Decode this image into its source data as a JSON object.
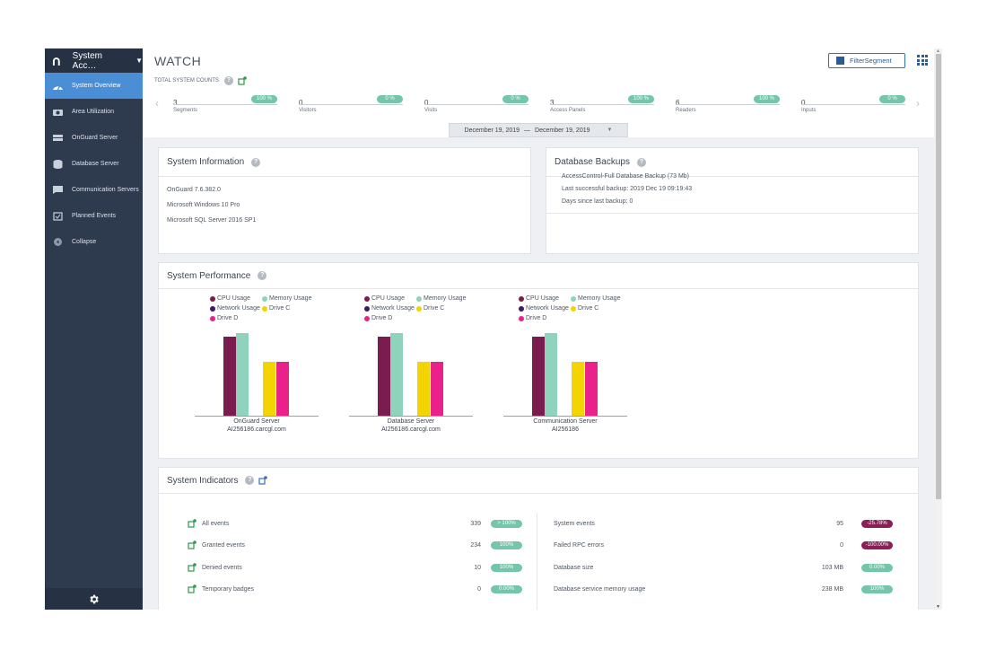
{
  "sidebar": {
    "account": "System Acc…",
    "items": [
      {
        "label": "System Overview",
        "icon": "gauge-icon",
        "active": true
      },
      {
        "label": "Area Utilization",
        "icon": "camera-icon",
        "active": false
      },
      {
        "label": "OnGuard Server",
        "icon": "server-icon",
        "active": false
      },
      {
        "label": "Database Server",
        "icon": "database-icon",
        "active": false
      },
      {
        "label": "Communication Servers",
        "icon": "chat-icon",
        "active": false
      },
      {
        "label": "Planned Events",
        "icon": "calendar-icon",
        "active": false
      },
      {
        "label": "Collapse",
        "icon": "collapse-icon",
        "active": false
      }
    ],
    "settings_icon": "gear-icon"
  },
  "header": {
    "title": "WATCH",
    "filter_button": "FilterSegment",
    "total_counts_label": "TOTAL SYSTEM COUNTS"
  },
  "counts": [
    {
      "value": "3",
      "label": "Segments",
      "pct": "100 %"
    },
    {
      "value": "0",
      "label": "Visitors",
      "pct": "0 %"
    },
    {
      "value": "0",
      "label": "Visits",
      "pct": "0 %"
    },
    {
      "value": "3",
      "label": "Access Panels",
      "pct": "100 %"
    },
    {
      "value": "6",
      "label": "Readers",
      "pct": "100 %"
    },
    {
      "value": "0",
      "label": "Inputs",
      "pct": "0 %"
    }
  ],
  "date_range": {
    "start": "December 19, 2019",
    "separator": "—",
    "end": "December 19, 2019"
  },
  "system_information": {
    "title": "System Information",
    "lines": [
      "OnGuard 7.6.382.0",
      "Microsoft Windows 10 Pro",
      "Microsoft SQL Server 2016 SP1"
    ]
  },
  "database_backups": {
    "title": "Database Backups",
    "lines": [
      "AccessControl-Full Database Backup (73 Mb)",
      "Last successful backup: 2019 Dec 19 09:19:43",
      "Days since last backup: 0"
    ]
  },
  "system_performance": {
    "title": "System Performance",
    "legend": [
      {
        "name": "CPU Usage",
        "color": "#7b1c4f"
      },
      {
        "name": "Memory Usage",
        "color": "#8fd3bd"
      },
      {
        "name": "Network Usage",
        "color": "#3d1b63"
      },
      {
        "name": "Drive C",
        "color": "#f4d400"
      },
      {
        "name": "Drive D",
        "color": "#e8228a"
      }
    ]
  },
  "chart_data": [
    {
      "type": "bar",
      "title": "",
      "categories": [
        "CPU Usage",
        "Memory Usage",
        "Drive C",
        "Drive D"
      ],
      "values": [
        88,
        92,
        60,
        60
      ],
      "ylim": [
        0,
        100
      ],
      "caption": [
        "OnGuard Server",
        "AI256186.carcgl.com"
      ]
    },
    {
      "type": "bar",
      "title": "",
      "categories": [
        "CPU Usage",
        "Memory Usage",
        "Drive C",
        "Drive D"
      ],
      "values": [
        88,
        92,
        60,
        60
      ],
      "ylim": [
        0,
        100
      ],
      "caption": [
        "Database Server",
        "AI256186.carcgl.com"
      ]
    },
    {
      "type": "bar",
      "title": "",
      "categories": [
        "CPU Usage",
        "Memory Usage",
        "Drive C",
        "Drive D"
      ],
      "values": [
        88,
        92,
        60,
        60
      ],
      "ylim": [
        0,
        100
      ],
      "caption": [
        "Communication Server",
        "AI256186"
      ]
    }
  ],
  "system_indicators": {
    "title": "System Indicators",
    "left": [
      {
        "label": "All events",
        "value": "339",
        "pct": "> 100%",
        "color": "green"
      },
      {
        "label": "Granted events",
        "value": "234",
        "pct": "100%",
        "color": "green"
      },
      {
        "label": "Denied events",
        "value": "10",
        "pct": "100%",
        "color": "green"
      },
      {
        "label": "Temporary badges",
        "value": "0",
        "pct": "0.00%",
        "color": "green"
      }
    ],
    "right": [
      {
        "label": "System events",
        "value": "95",
        "pct": "-25.78%",
        "color": "purple"
      },
      {
        "label": "Failed RPC errors",
        "value": "0",
        "pct": "-100.00%",
        "color": "purple"
      },
      {
        "label": "Database size",
        "value": "103 MB",
        "pct": "0.00%",
        "color": "green"
      },
      {
        "label": "Database service memory usage",
        "value": "238 MB",
        "pct": "100%",
        "color": "green"
      }
    ]
  }
}
